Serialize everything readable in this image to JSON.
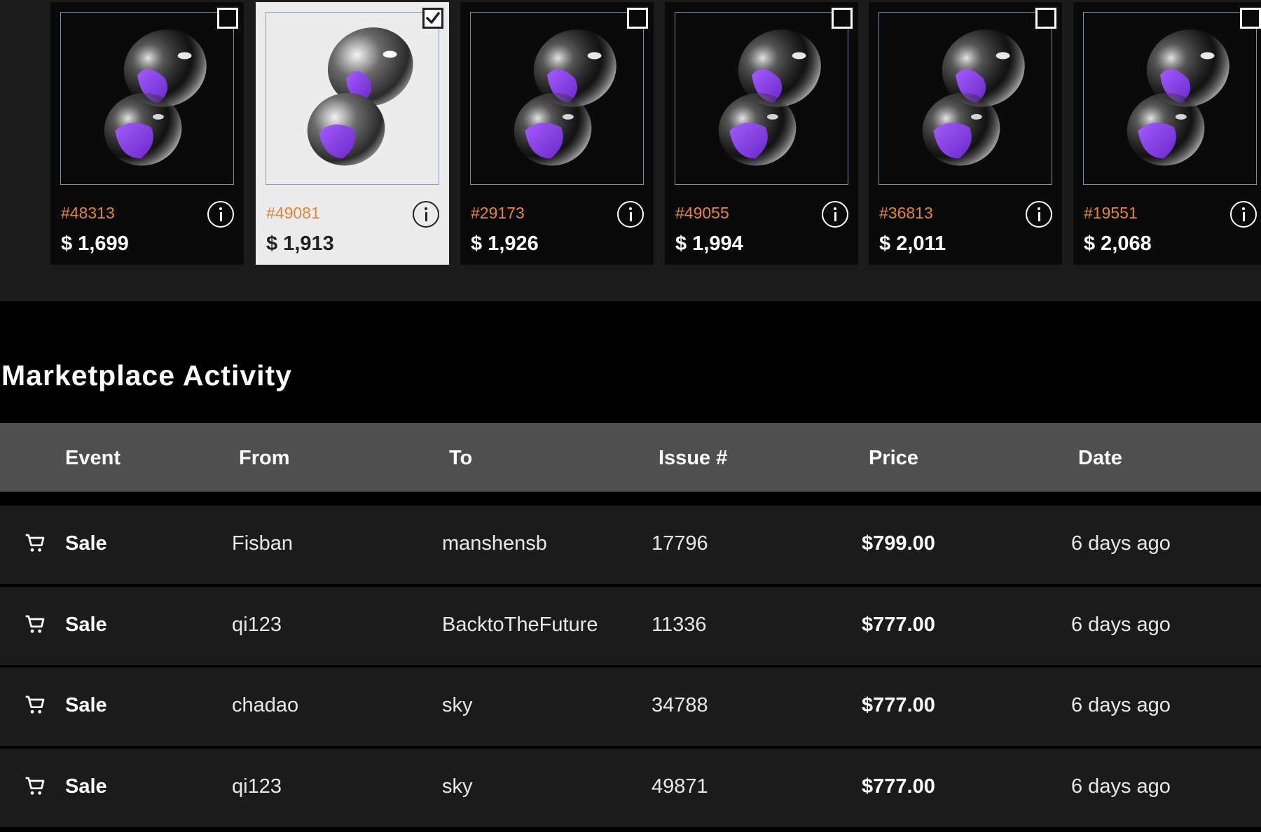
{
  "cards": [
    {
      "issue": "#48313",
      "price": "$ 1,699",
      "checked": false
    },
    {
      "issue": "#49081",
      "price": "$ 1,913",
      "checked": true
    },
    {
      "issue": "#29173",
      "price": "$ 1,926",
      "checked": false
    },
    {
      "issue": "#49055",
      "price": "$ 1,994",
      "checked": false
    },
    {
      "issue": "#36813",
      "price": "$ 2,011",
      "checked": false
    },
    {
      "issue": "#19551",
      "price": "$ 2,068",
      "checked": false
    }
  ],
  "activity": {
    "title": "Marketplace Activity",
    "columns": [
      "Event",
      "From",
      "To",
      "Issue #",
      "Price",
      "Date"
    ],
    "rows": [
      {
        "event": "Sale",
        "from": "Fisban",
        "to": "manshensb",
        "issue": "17796",
        "price": "$799.00",
        "date": "6 days ago"
      },
      {
        "event": "Sale",
        "from": "qi123",
        "to": "BacktoTheFuture",
        "issue": "11336",
        "price": "$777.00",
        "date": "6 days ago"
      },
      {
        "event": "Sale",
        "from": "chadao",
        "to": "sky",
        "issue": "34788",
        "price": "$777.00",
        "date": "6 days ago"
      },
      {
        "event": "Sale",
        "from": "qi123",
        "to": "sky",
        "issue": "49871",
        "price": "$777.00",
        "date": "6 days ago"
      }
    ]
  },
  "icons": {
    "event": "cart-icon",
    "info": "info-icon",
    "item": "hourglass-icon"
  },
  "colors": {
    "issue": "#e0853d",
    "accent_purple": "#8a3ee0",
    "header_bg": "#4f4f4f",
    "row_bg": "#1b1b1b"
  }
}
